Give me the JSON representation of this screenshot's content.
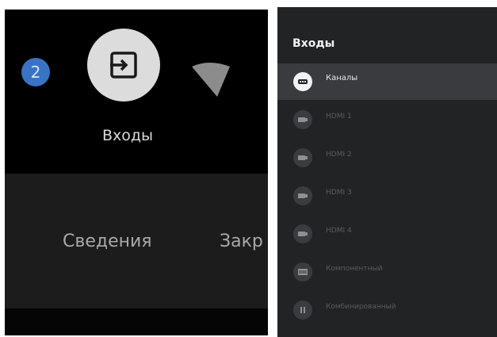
{
  "left_panel": {
    "badge_number": "2",
    "inputs_label": "Входы",
    "menu_items": [
      "Сведения",
      "Закр"
    ]
  },
  "right_panel": {
    "title": "Входы",
    "items": [
      {
        "label": "Каналы",
        "icon": "tv-channels-icon",
        "selected": true
      },
      {
        "label": "HDMI 1",
        "icon": "hdmi-icon",
        "selected": false
      },
      {
        "label": "HDMI 2",
        "icon": "hdmi-icon",
        "selected": false
      },
      {
        "label": "HDMI 3",
        "icon": "hdmi-icon",
        "selected": false
      },
      {
        "label": "HDMI 4",
        "icon": "hdmi-icon",
        "selected": false
      },
      {
        "label": "Компонентный",
        "icon": "component-icon",
        "selected": false
      },
      {
        "label": "Комбинированный",
        "icon": "composite-icon",
        "selected": false
      }
    ]
  },
  "colors": {
    "badge": "#3a73c4",
    "panel_bg": "#222325",
    "selected_row": "#3a3b3e"
  }
}
